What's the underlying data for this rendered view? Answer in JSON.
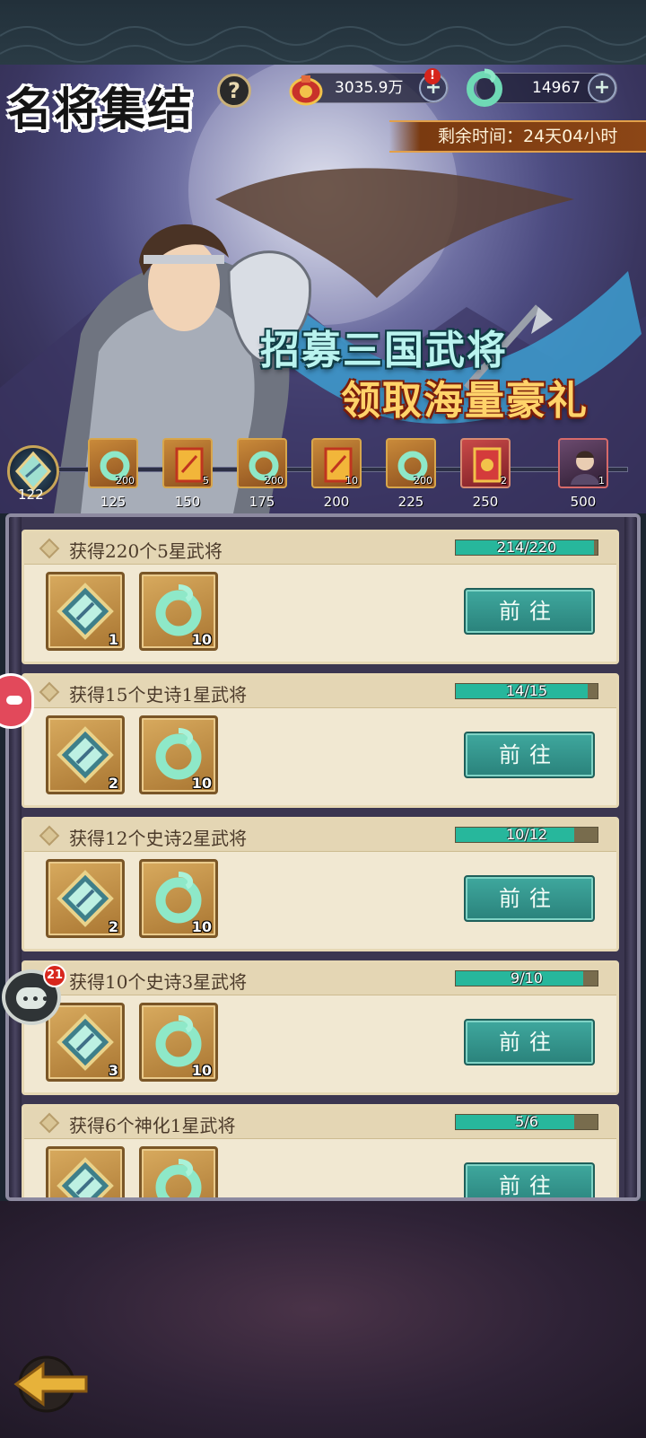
{
  "header": {
    "title": "名将集结",
    "help_label": "?",
    "gold": {
      "value": "3035.9万",
      "alert": "!"
    },
    "jade": {
      "value": "14967"
    },
    "plus_label": "+",
    "timer": "剩余时间：24天04小时"
  },
  "banner": {
    "slogan_line1": "招募三国武将",
    "slogan_line2": "领取海量豪礼"
  },
  "milestones": {
    "current_points": "122",
    "progress_fraction": 0.0,
    "items": [
      {
        "threshold": "125",
        "count": "200",
        "icon": "jade-ring-icon",
        "style": "gold"
      },
      {
        "threshold": "150",
        "count": "5",
        "icon": "recruit-card-icon",
        "style": "gold"
      },
      {
        "threshold": "175",
        "count": "200",
        "icon": "jade-ring-icon",
        "style": "gold"
      },
      {
        "threshold": "200",
        "count": "10",
        "icon": "recruit-card-icon",
        "style": "gold"
      },
      {
        "threshold": "225",
        "count": "200",
        "icon": "jade-ring-icon",
        "style": "gold"
      },
      {
        "threshold": "250",
        "count": "2",
        "icon": "red-card-icon",
        "style": "red"
      },
      {
        "threshold": "500",
        "count": "1",
        "icon": "hero-portrait-icon",
        "style": "hero"
      }
    ]
  },
  "tasks": [
    {
      "title": "获得220个5星武将",
      "progress_text": "214/220",
      "progress": 0.973,
      "rewards": [
        {
          "icon": "token-badge-icon",
          "count": "1"
        },
        {
          "icon": "jade-ring-icon",
          "count": "10"
        }
      ],
      "button": "前往"
    },
    {
      "title": "获得15个史诗1星武将",
      "progress_text": "14/15",
      "progress": 0.933,
      "rewards": [
        {
          "icon": "token-badge-icon",
          "count": "2"
        },
        {
          "icon": "jade-ring-icon",
          "count": "10"
        }
      ],
      "button": "前往"
    },
    {
      "title": "获得12个史诗2星武将",
      "progress_text": "10/12",
      "progress": 0.833,
      "rewards": [
        {
          "icon": "token-badge-icon",
          "count": "2"
        },
        {
          "icon": "jade-ring-icon",
          "count": "10"
        }
      ],
      "button": "前往"
    },
    {
      "title": "获得10个史诗3星武将",
      "progress_text": "9/10",
      "progress": 0.9,
      "rewards": [
        {
          "icon": "token-badge-icon",
          "count": "3"
        },
        {
          "icon": "jade-ring-icon",
          "count": "10"
        }
      ],
      "button": "前往"
    },
    {
      "title": "获得6个神化1星武将",
      "progress_text": "5/6",
      "progress": 0.833,
      "rewards": [
        {
          "icon": "token-badge-icon",
          "count": ""
        },
        {
          "icon": "jade-ring-icon",
          "count": ""
        }
      ],
      "button": "前往"
    }
  ],
  "chat": {
    "badge": "21",
    "icon": "chat-icon"
  },
  "colors": {
    "accent_teal": "#2a827b",
    "progress_fill": "#27b79c",
    "gold_border": "#d7a64c"
  }
}
